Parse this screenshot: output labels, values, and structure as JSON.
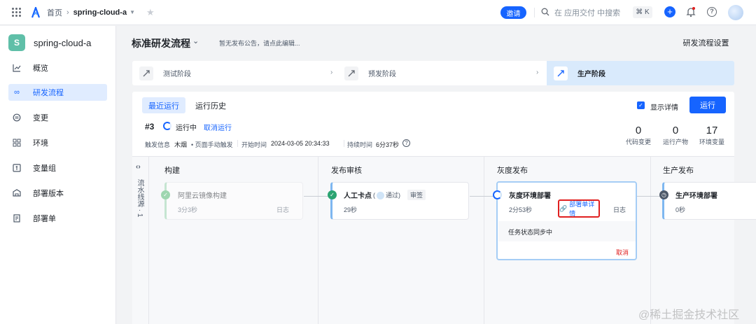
{
  "topbar": {
    "home": "首页",
    "project": "spring-cloud-a",
    "invite": "邀请",
    "search_placeholder": "在 应用交付 中搜索",
    "shortcut": "⌘ K"
  },
  "sidebar": {
    "project_badge": "S",
    "project_name": "spring-cloud-a",
    "items": [
      {
        "label": "概览",
        "icon": "chart-line-icon"
      },
      {
        "label": "研发流程",
        "icon": "infinity-icon",
        "active": true
      },
      {
        "label": "变更",
        "icon": "change-icon"
      },
      {
        "label": "环境",
        "icon": "grid-icon"
      },
      {
        "label": "变量组",
        "icon": "variable-icon"
      },
      {
        "label": "部署版本",
        "icon": "package-icon"
      },
      {
        "label": "部署单",
        "icon": "document-icon"
      }
    ]
  },
  "header": {
    "title": "标准研发流程",
    "announcement": "暂无发布公告，请点此编辑...",
    "settings_button": "研发流程设置"
  },
  "stages": [
    {
      "label": "测试阶段"
    },
    {
      "label": "预发阶段"
    },
    {
      "label": "生产阶段",
      "current": true
    }
  ],
  "run": {
    "tabs": [
      "最近运行",
      "运行历史"
    ],
    "show_details": "显示详情",
    "run_button": "运行",
    "number": "#3",
    "status": "运行中",
    "cancel": "取消运行",
    "trigger_label": "触发信息",
    "trigger_user": "木烟",
    "trigger_type": "• 页面手动触发",
    "start_label": "开始时间",
    "start_time": "2024-03-05 20:34:33",
    "duration_label": "持续时间",
    "duration": "6分37秒",
    "stats": [
      {
        "value": "0",
        "label": "代码变更"
      },
      {
        "value": "0",
        "label": "运行产物"
      },
      {
        "value": "17",
        "label": "环境变量"
      }
    ]
  },
  "pipeline": {
    "line_label": "流水线源 · 1",
    "columns": [
      "构建",
      "发布审核",
      "灰度发布",
      "生产发布"
    ],
    "jobs": {
      "build": {
        "name": "阿里云镜像构建",
        "time": "3分3秒",
        "log": "日志"
      },
      "review": {
        "name": "人工卡点",
        "passed_prefix": "(",
        "passed": "通过)",
        "tag": "审签",
        "time": "29秒"
      },
      "gray": {
        "name": "灰度环境部署",
        "time": "2分53秒",
        "detail_link": "部署单详情",
        "log": "日志",
        "sync_status": "任务状态同步中",
        "cancel": "取消"
      },
      "prod": {
        "name": "生产环境部署",
        "time": "0秒"
      }
    }
  },
  "watermark": "@稀土掘金技术社区",
  "colors": {
    "primary": "#1664ff",
    "success": "#2ba471",
    "danger": "#e02020"
  }
}
